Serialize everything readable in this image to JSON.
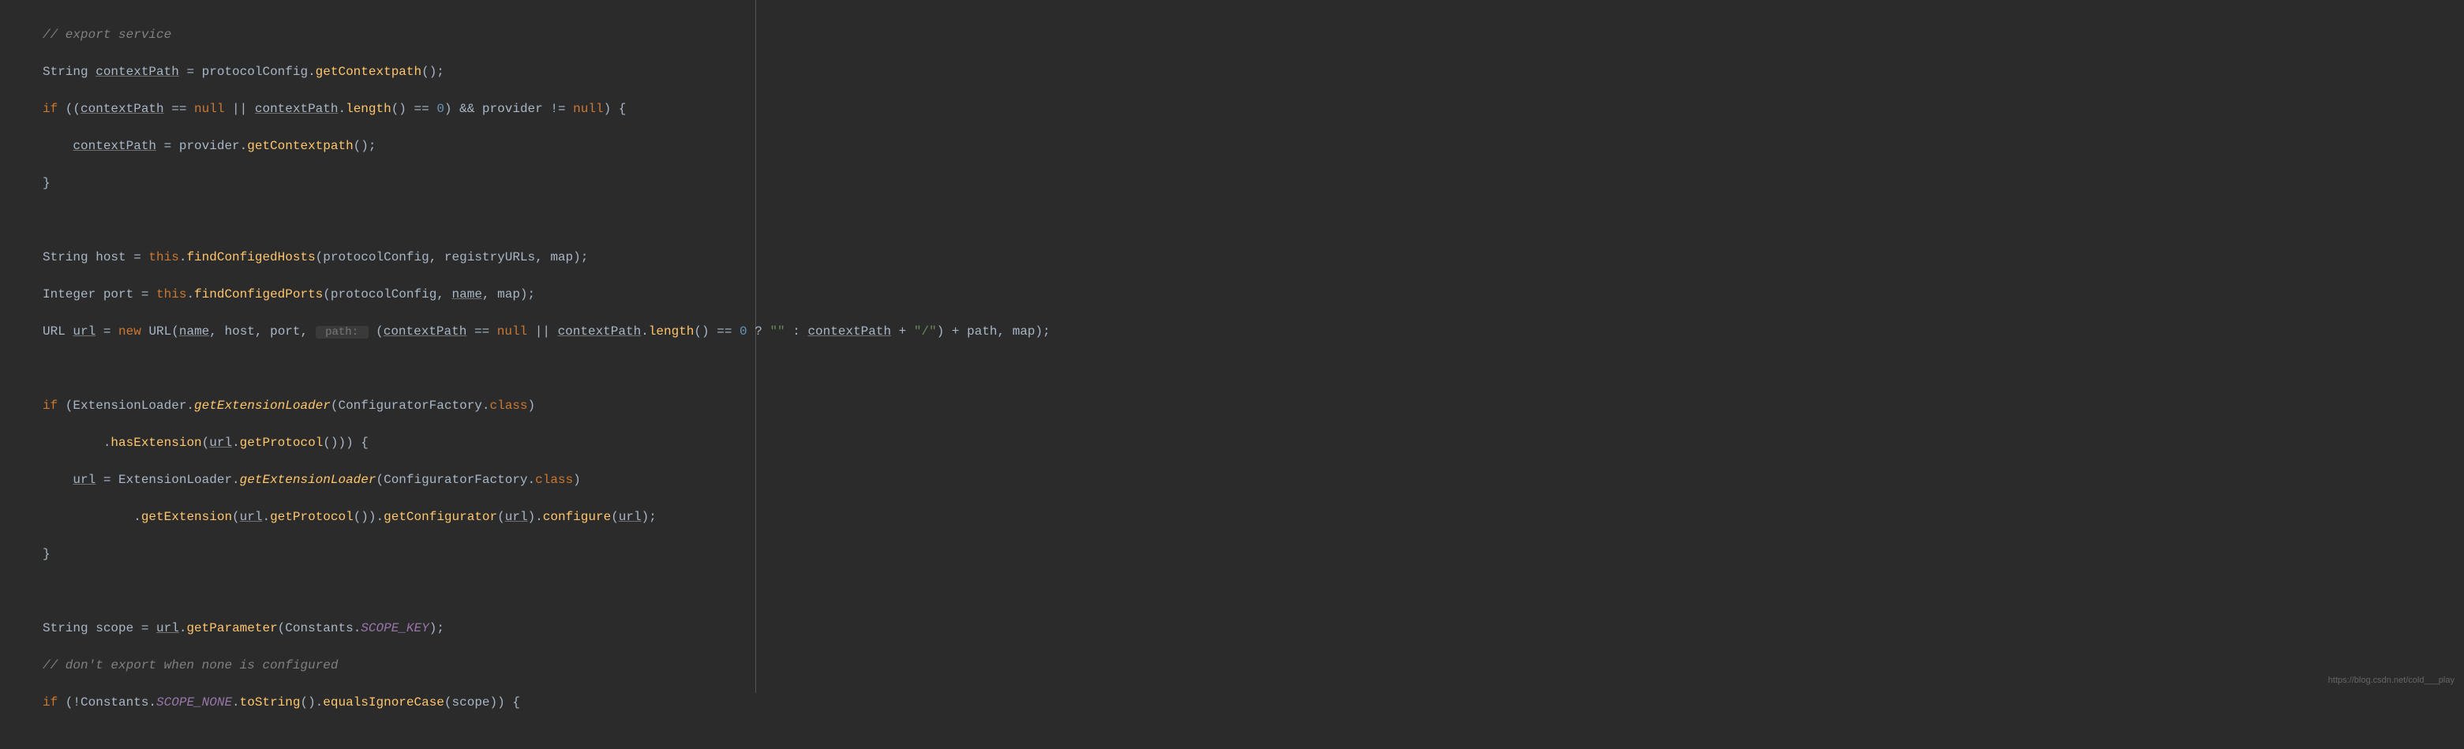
{
  "watermark": "https://blog.csdn.net/cold___play",
  "code": {
    "line1": {
      "comment": "// export service"
    },
    "line2": {
      "type": "String",
      "var": "contextPath",
      "assign": " = protocolConfig.",
      "method": "getContextpath",
      "end": "();"
    },
    "line3": {
      "if": "if",
      "open": " ((",
      "var1": "contextPath",
      "eq1": " == ",
      "null1": "null",
      "or": " || ",
      "var2": "contextPath",
      "dot": ".",
      "method": "length",
      "parens": "() == ",
      "zero": "0",
      "close1": ") && provider != ",
      "null2": "null",
      "close2": ") {"
    },
    "line4": {
      "var": "contextPath",
      "assign": " = provider.",
      "method": "getContextpath",
      "end": "();"
    },
    "line5": {
      "brace": "}"
    },
    "line7": {
      "type": "String",
      "var": " host = ",
      "this": "this",
      "dot": ".",
      "method": "findConfigedHosts",
      "args": "(protocolConfig, registryURLs, map);"
    },
    "line8": {
      "type": "Integer",
      "var": " port = ",
      "this": "this",
      "dot": ".",
      "method": "findConfigedPorts",
      "args": "(protocolConfig, ",
      "name": "name",
      "end": ", map);"
    },
    "line9": {
      "type": "URL ",
      "var": "url",
      "assign": " = ",
      "new": "new",
      "sp": " ",
      "class": "URL",
      "open": "(",
      "name": "name",
      "args1": ", host, port, ",
      "hint": " path: ",
      "open2": " (",
      "cp1": "contextPath",
      "eq": " == ",
      "null": "null",
      "or": " || ",
      "cp2": "contextPath",
      "dot": ".",
      "method": "length",
      "parens": "() == ",
      "zero": "0",
      "tern": " ? ",
      "str1": "\"\"",
      "colon": " : ",
      "cp3": "contextPath",
      "plus": " + ",
      "str2": "\"/\"",
      "close": ") + path, map);"
    },
    "line11": {
      "if": "if",
      "open": " (ExtensionLoader.",
      "method": "getExtensionLoader",
      "args": "(ConfiguratorFactory.",
      "class": "class",
      "close": ")"
    },
    "line12": {
      "indent": "        .",
      "method1": "hasExtension",
      "open": "(",
      "url": "url",
      "dot": ".",
      "method2": "getProtocol",
      "close": "())) {"
    },
    "line13": {
      "url": "url",
      "assign": " = ExtensionLoader.",
      "method": "getExtensionLoader",
      "args": "(ConfiguratorFactory.",
      "class": "class",
      "close": ")"
    },
    "line14": {
      "indent": "            .",
      "method1": "getExtension",
      "open1": "(",
      "url1": "url",
      "dot1": ".",
      "method2": "getProtocol",
      "close1": "()).",
      "method3": "getConfigurator",
      "open2": "(",
      "url2": "url",
      "close2": ").",
      "method4": "configure",
      "open3": "(",
      "url3": "url",
      "close3": ");"
    },
    "line15": {
      "brace": "}"
    },
    "line17": {
      "type": "String",
      "var": " scope = ",
      "url": "url",
      "dot": ".",
      "method": "getParameter",
      "open": "(Constants.",
      "field": "SCOPE_KEY",
      "close": ");"
    },
    "line18": {
      "comment": "// don't export when none is configured"
    },
    "line19": {
      "if": "if",
      "open": " (!Constants.",
      "field": "SCOPE_NONE",
      "dot1": ".",
      "method1": "toString",
      "parens1": "().",
      "method2": "equalsIgnoreCase",
      "args": "(scope)) {"
    }
  }
}
